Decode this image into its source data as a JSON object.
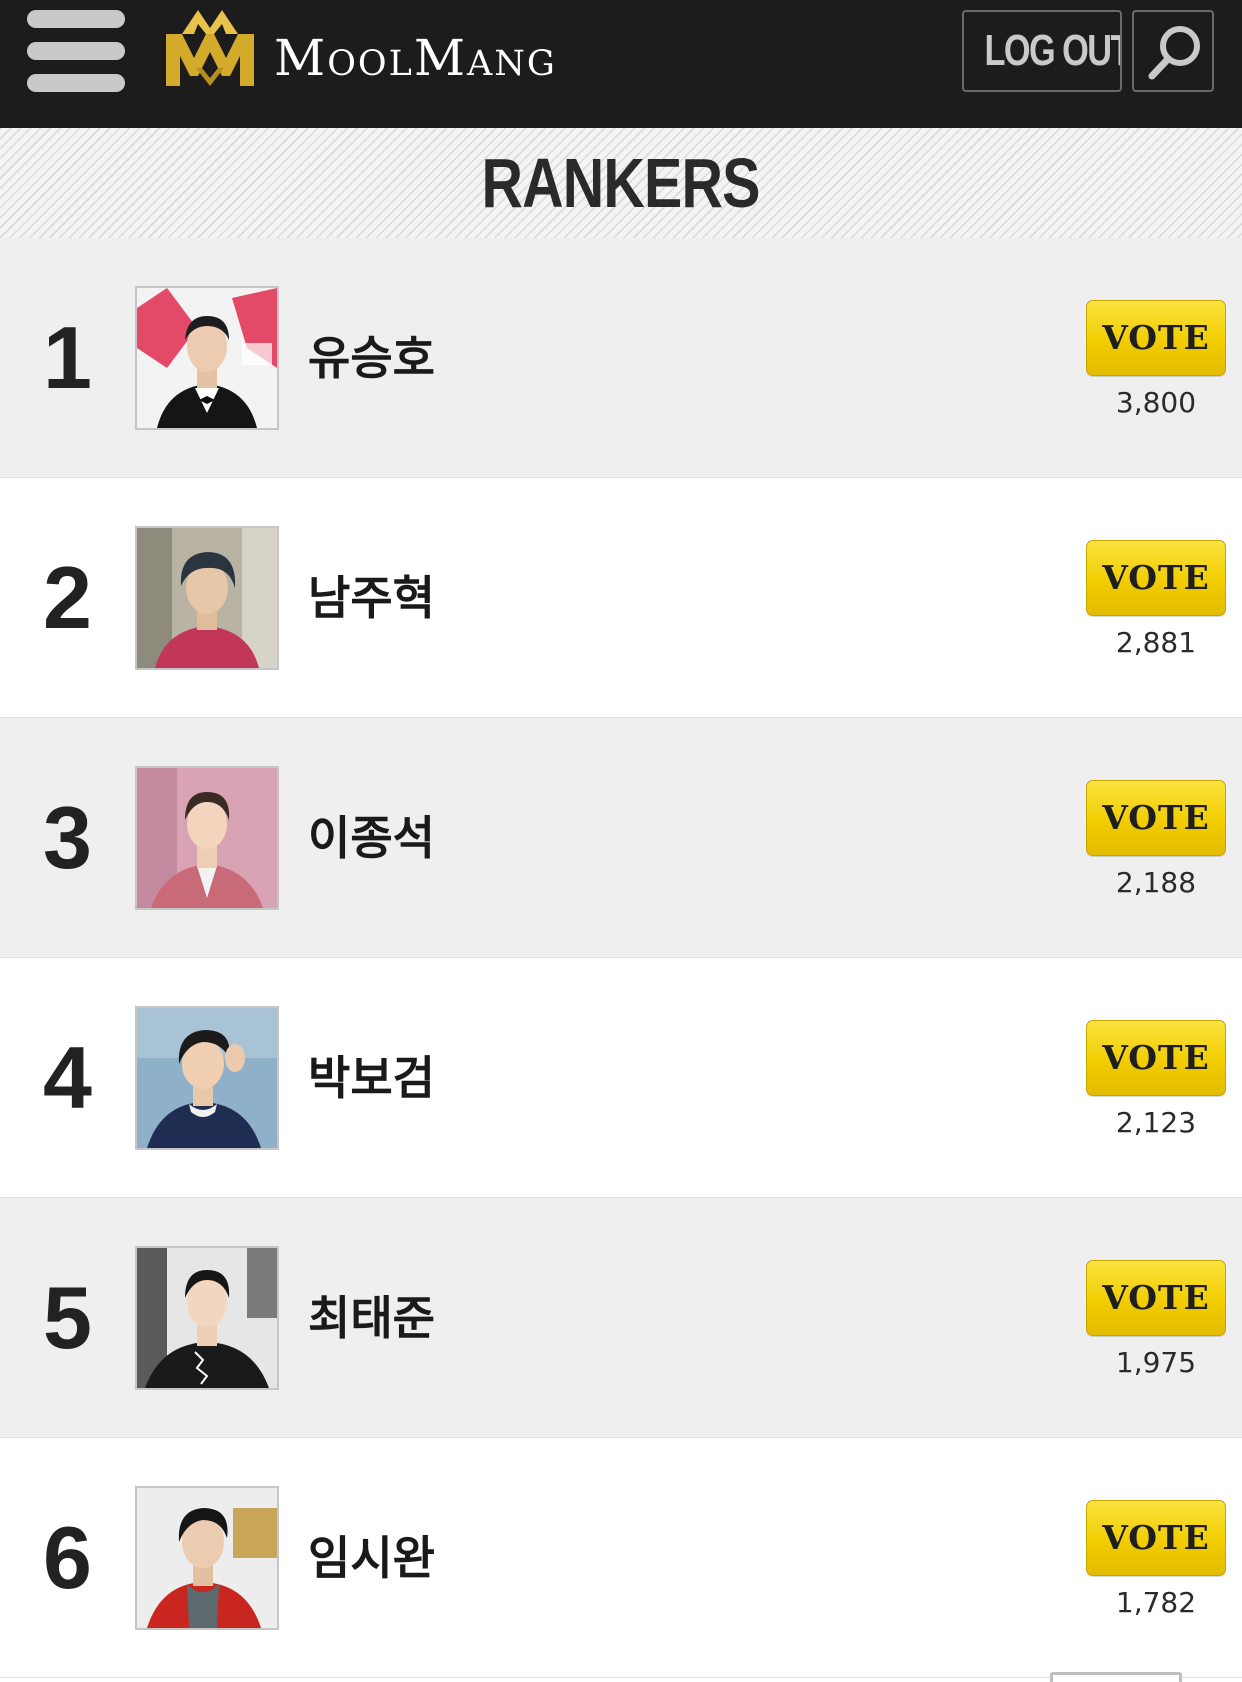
{
  "header": {
    "menu_icon": "hamburger-menu-icon",
    "logo_mark_icon": "crown-mm-logo",
    "logo_text": "MoolMang",
    "logout_label": "LOG OUT",
    "search_icon": "search-icon",
    "colors": {
      "bar": "#1c1c1c",
      "logo_gold": "#d4aa2a",
      "button_border": "#6a6a6a"
    }
  },
  "section": {
    "title": "RANKERS"
  },
  "vote": {
    "color": "#f1cd00"
  },
  "rankers": [
    {
      "rank": "1",
      "name": "유승호",
      "vote_label": "VOTE",
      "votes": "3,800"
    },
    {
      "rank": "2",
      "name": "남주혁",
      "vote_label": "VOTE",
      "votes": "2,881"
    },
    {
      "rank": "3",
      "name": "이종석",
      "vote_label": "VOTE",
      "votes": "2,188"
    },
    {
      "rank": "4",
      "name": "박보검",
      "vote_label": "VOTE",
      "votes": "2,123"
    },
    {
      "rank": "5",
      "name": "최태준",
      "vote_label": "VOTE",
      "votes": "1,975"
    },
    {
      "rank": "6",
      "name": "임시완",
      "vote_label": "VOTE",
      "votes": "1,782"
    }
  ]
}
